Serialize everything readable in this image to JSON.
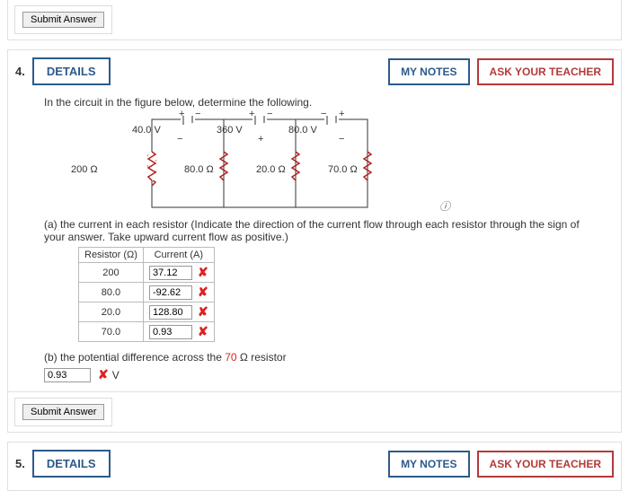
{
  "top_block": {
    "submit": "Submit Answer"
  },
  "q4": {
    "number": "4.",
    "details": "DETAILS",
    "mynotes": "MY NOTES",
    "askteacher": "ASK YOUR TEACHER",
    "prompt": "In the circuit in the figure below, determine the following.",
    "circuit": {
      "v1": "40.0 V",
      "v2": "360 V",
      "v3": "80.0 V",
      "r1": "200 Ω",
      "r2": "80.0 Ω",
      "r3": "20.0 Ω",
      "r4": "70.0 Ω",
      "plus": "+",
      "minus": "−"
    },
    "part_a": "(a) the current in each resistor (Indicate the direction of the current flow through each resistor through the sign of your answer. Take upward current flow as positive.)",
    "table": {
      "h1": "Resistor (Ω)",
      "h2": "Current (A)",
      "rows": [
        {
          "r": "200",
          "i": "37.12"
        },
        {
          "r": "80.0",
          "i": "-92.62"
        },
        {
          "r": "20.0",
          "i": "128.80"
        },
        {
          "r": "70.0",
          "i": "0.93"
        }
      ]
    },
    "part_b_text_1": "(b) the potential difference across the ",
    "part_b_red": "70",
    "part_b_text_2": " Ω resistor",
    "part_b_val": "0.93",
    "part_b_unit": "V",
    "submit": "Submit Answer"
  },
  "q5": {
    "number": "5.",
    "details": "DETAILS",
    "mynotes": "MY NOTES",
    "askteacher": "ASK YOUR TEACHER"
  }
}
